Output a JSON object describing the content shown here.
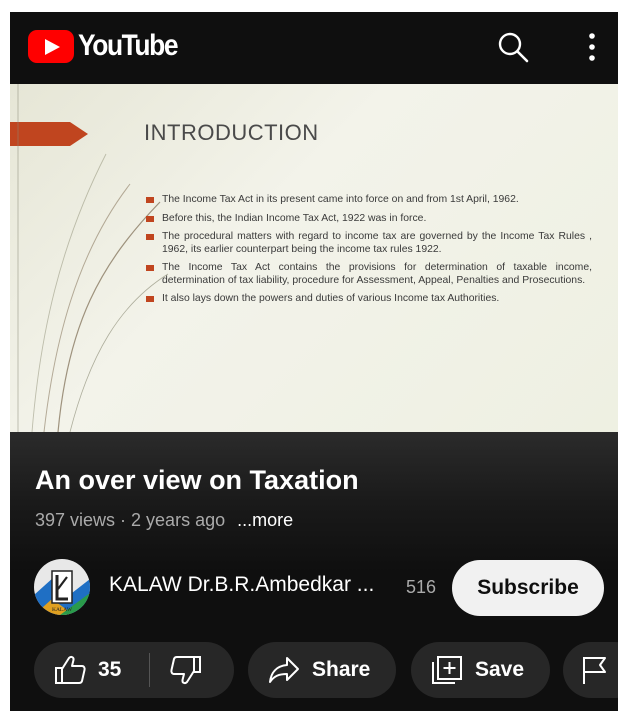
{
  "header": {
    "brand": "YouTube"
  },
  "slide": {
    "title": "INTRODUCTION",
    "bullets": [
      "The Income Tax Act in its present came into force on and from 1st April, 1962.",
      "Before this, the Indian Income Tax Act, 1922 was in force.",
      "The procedural matters with regard to income tax are governed by the Income Tax Rules , 1962, its earlier counterpart being the income tax rules 1922.",
      "The Income Tax Act contains the provisions for determination of taxable income, determination of tax liability, procedure for Assessment, Appeal, Penalties and Prosecutions.",
      "It also lays down the powers and duties of various Income tax Authorities."
    ]
  },
  "video": {
    "title": "An over view on Taxation",
    "meta": "397 views · 2 years ago",
    "more_label": "...more"
  },
  "channel": {
    "name": "KALAW Dr.B.R.Ambedkar ...",
    "subscribers": "516",
    "subscribe_label": "Subscribe",
    "avatar_text": "KALAW"
  },
  "actions": {
    "likes": "35",
    "share_label": "Share",
    "save_label": "Save"
  },
  "icons": [
    "search-icon",
    "more-vert-icon",
    "thumbs-up-icon",
    "thumbs-down-icon",
    "share-icon",
    "save-playlist-icon",
    "flag-icon"
  ],
  "colors": {
    "brand": "#ff0000",
    "background": "#0f0f0f",
    "pill": "#272727",
    "bullet": "#c0451f"
  }
}
